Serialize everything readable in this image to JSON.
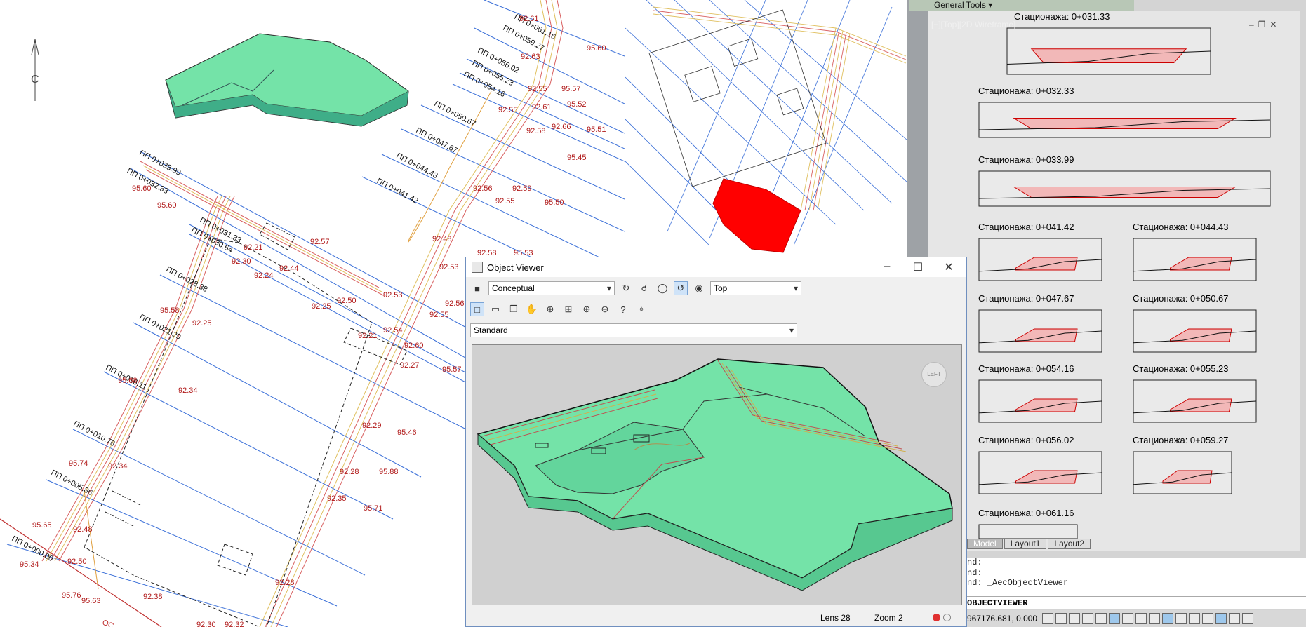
{
  "plan": {
    "north_letter": "C",
    "station_labels": [
      "ПП 0+061.16",
      "ПП 0+059.27",
      "ПП 0+056.02",
      "ПП 0+055.23",
      "ПП 0+054.16",
      "ПП 0+050.67",
      "ПП 0+047.67",
      "ПП 0+044.43",
      "ПП 0+041.42",
      "ПП 0+033.99",
      "ПП 0+032.33",
      "ПП 0+031.33",
      "ПП 0+030.64",
      "ПП 0+028.38",
      "ПП 0+021.29",
      "ПП 0+016.11",
      "ПП 0+010.76",
      "ПП 0+005.86",
      "ПП 0+000.00"
    ],
    "elevations": [
      "92.61",
      "95.60",
      "92.63",
      "92.55",
      "95.57",
      "92.61",
      "95.52",
      "92.55",
      "92.66",
      "92.58",
      "95.51",
      "95.45",
      "92.59",
      "92.56",
      "95.50",
      "92.55",
      "95.60",
      "95.60",
      "92.57",
      "92.48",
      "92.21",
      "92.30",
      "92.24",
      "92.44",
      "92.53",
      "92.58",
      "95.53",
      "92.53",
      "92.50",
      "92.25",
      "92.56",
      "95.58",
      "92.25",
      "92.55",
      "92.54",
      "92.21",
      "92.60",
      "92.27",
      "95.57",
      "95.68",
      "92.34",
      "92.29",
      "95.46",
      "95.74",
      "92.34",
      "92.28",
      "95.88",
      "92.35",
      "95.71",
      "95.65",
      "92.48",
      "92.50",
      "95.34",
      "95.76",
      "95.63",
      "92.38",
      "92.28",
      "92.30",
      "92.32"
    ],
    "bottom_text": "ОС"
  },
  "cad": {
    "toolbar_label": "General Tools",
    "viewport_label": "[−][Top][2D Wireframe]",
    "cross_sections": [
      "Стационажа: 0+031.33",
      "Стационажа: 0+032.33",
      "Стационажа: 0+033.99",
      "Стационажа: 0+041.42",
      "Стационажа: 0+044.43",
      "Стационажа: 0+047.67",
      "Стационажа: 0+050.67",
      "Стационажа: 0+054.16",
      "Стационажа: 0+055.23",
      "Стационажа: 0+056.02",
      "Стационажа: 0+059.27",
      "Стационажа: 0+061.16"
    ],
    "layout_tabs": [
      "Model",
      "Layout1",
      "Layout2"
    ],
    "command_history": [
      "nd:",
      "nd:",
      "nd:  _AecObjectViewer"
    ],
    "command_input": "OBJECTVIEWER",
    "coords": "967176.681, 0.000"
  },
  "object_viewer": {
    "title": "Object Viewer",
    "visual_style": "Conceptual",
    "view": "Top",
    "display_config": "Standard",
    "lens": "Lens 28",
    "zoom": "Zoom 2",
    "viewcube_face": "LEFT"
  },
  "colors": {
    "surface_green": "#74e3a8",
    "contour_red": "#c0392b",
    "contour_yellow": "#e0c060",
    "grid_blue": "#3a6fd8",
    "label_red": "#b01818",
    "fill_red": "#ff0000"
  }
}
